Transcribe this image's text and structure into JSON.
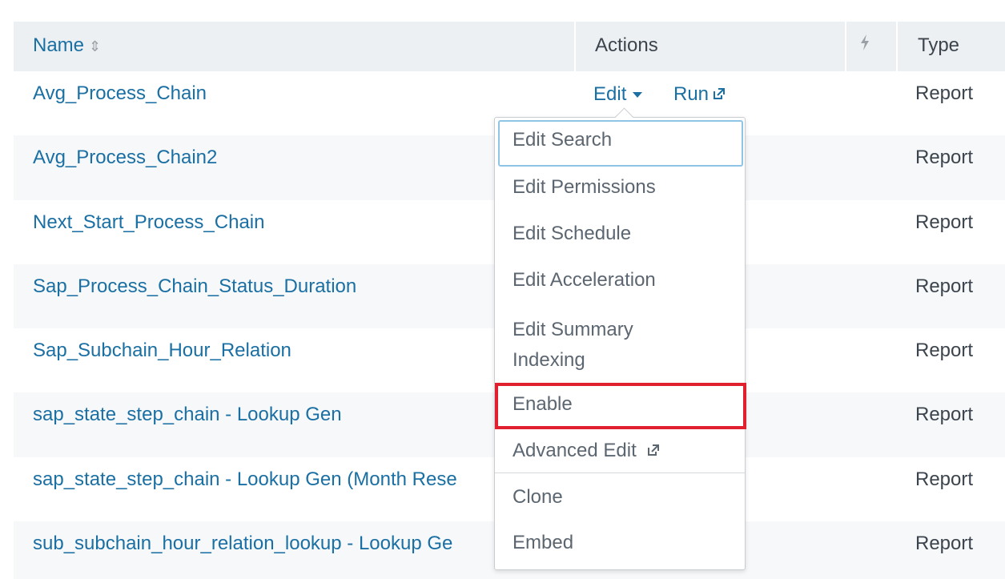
{
  "table": {
    "columns": {
      "name": "Name",
      "actions": "Actions",
      "type": "Type"
    },
    "icons": {
      "sort": "sort-icon",
      "lightning": "lightning-icon"
    },
    "rows": [
      {
        "name": "Avg_Process_Chain",
        "type": "Report"
      },
      {
        "name": "Avg_Process_Chain2",
        "type": "Report"
      },
      {
        "name": "Next_Start_Process_Chain",
        "type": "Report"
      },
      {
        "name": "Sap_Process_Chain_Status_Duration",
        "type": "Report"
      },
      {
        "name": "Sap_Subchain_Hour_Relation",
        "type": "Report"
      },
      {
        "name": "sap_state_step_chain - Lookup Gen",
        "type": "Report"
      },
      {
        "name": "sap_state_step_chain - Lookup Gen (Month Rese",
        "type": "Report"
      },
      {
        "name": "sub_subchain_hour_relation_lookup - Lookup Ge",
        "type": "Report"
      }
    ]
  },
  "row_actions": {
    "edit": "Edit",
    "run": "Run"
  },
  "menu": {
    "items": {
      "edit_search": "Edit Search",
      "edit_permissions": "Edit Permissions",
      "edit_schedule": "Edit Schedule",
      "edit_acceleration": "Edit Acceleration",
      "edit_summary_line1": "Edit Summary",
      "edit_summary_line2": "Indexing",
      "enable": "Enable",
      "advanced_edit": "Advanced Edit",
      "clone": "Clone",
      "embed": "Embed"
    }
  },
  "colors": {
    "link": "#1a6fa3",
    "header_bg": "#edf0f2",
    "highlight": "#e0202e",
    "focus": "#8ec4e6"
  }
}
